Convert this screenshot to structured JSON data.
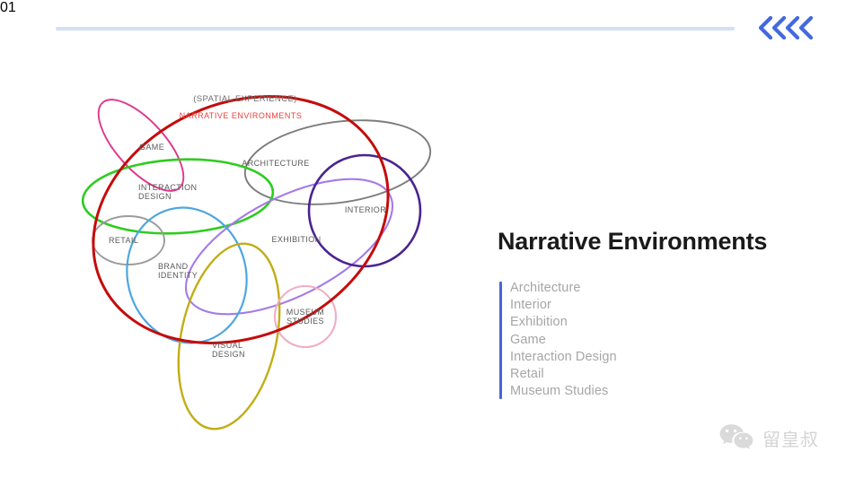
{
  "header": {
    "page_number": "01",
    "nav_icon": "chevrons-left-icon",
    "accent_color": "#4a74e8",
    "rule_color": "#d3dff5"
  },
  "diagram": {
    "name": "narrative-environments-venn-diagram",
    "headline_secondary": "(SPATIAL EXPERIENCE)",
    "headline_primary": "NARRATIVE ENVIRONMENTS",
    "headline_primary_color": "#e8403a",
    "shapes": [
      {
        "label": "GAME",
        "color": "#e0368c",
        "shape": "ellipse"
      },
      {
        "label": "INTERACTION DESIGN",
        "color": "#2ecc1f",
        "shape": "ellipse"
      },
      {
        "label": "RETAIL",
        "color": "#9b9b9b",
        "shape": "ellipse"
      },
      {
        "label": "BRAND IDENTITY",
        "color": "#4da6e0",
        "shape": "ellipse"
      },
      {
        "label": "VISUAL DESIGN",
        "color": "#c0ae16",
        "shape": "ellipse"
      },
      {
        "label": "ARCHITECTURE",
        "color": "#7c7c7c",
        "shape": "ellipse"
      },
      {
        "label": "INTERIOR",
        "color": "#4b2391",
        "shape": "circle"
      },
      {
        "label": "EXHIBITION",
        "color": "#a47ae8",
        "shape": "ellipse"
      },
      {
        "label": "MUSEUM STUDIES",
        "color": "#f0aec4",
        "shape": "circle"
      },
      {
        "label": "NARRATIVE ENVIRONMENTS",
        "color": "#c50b0b",
        "shape": "ellipse"
      }
    ],
    "labels": {
      "game": "GAME",
      "interaction_design_line1": "INTERACTION",
      "interaction_design_line2": "DESIGN",
      "retail": "RETAIL",
      "brand_identity_line1": "BRAND",
      "brand_identity_line2": "IDENTITY",
      "visual_design_line1": "VISUAL",
      "visual_design_line2": "DESIGN",
      "architecture": "ARCHITECTURE",
      "interior": "INTERIOR",
      "exhibition": "EXHIBITION",
      "museum_studies_line1": "MUSEUM",
      "museum_studies_line2": "STUDIES"
    }
  },
  "panel": {
    "title": "Narrative Environments",
    "bar_color": "#4a63d8",
    "items": [
      "Architecture",
      "Interior",
      "Exhibition",
      "Game",
      "Interaction Design",
      "Retail",
      "Museum Studies"
    ]
  },
  "watermark": {
    "icon": "wechat-icon",
    "text": "留皇叔"
  }
}
